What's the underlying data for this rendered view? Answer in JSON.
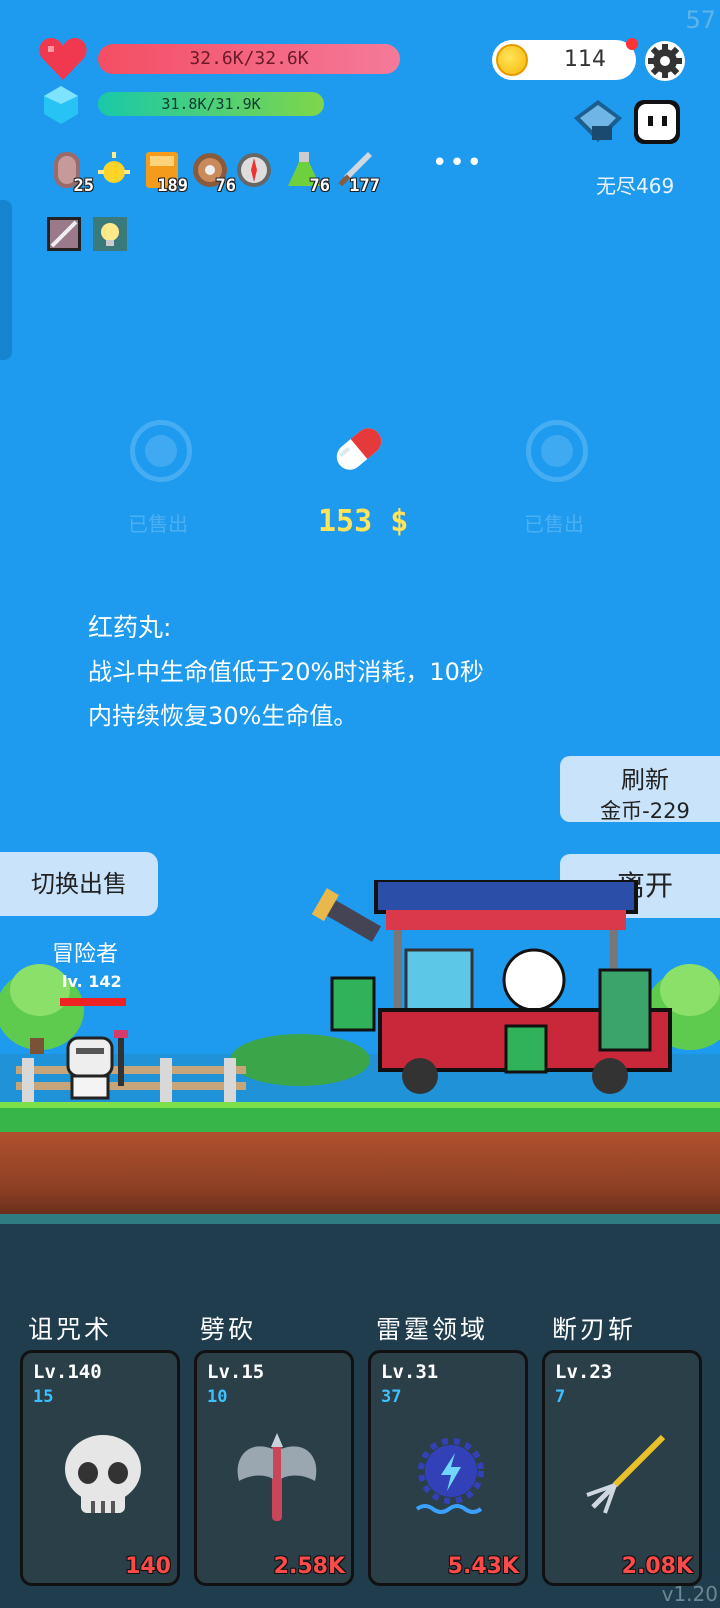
{
  "status": {
    "fps": "57",
    "hp": "32.6K/32.6K",
    "mp": "31.8K/31.9K",
    "coins": "114",
    "mode": "无尽469"
  },
  "buffs": [
    {
      "icon": "tombstone-icon",
      "count": "25"
    },
    {
      "icon": "sun-icon",
      "count": ""
    },
    {
      "icon": "book-icon",
      "count": "189"
    },
    {
      "icon": "shield-icon",
      "count": "76"
    },
    {
      "icon": "compass-icon",
      "count": ""
    },
    {
      "icon": "potion-icon",
      "count": "76"
    },
    {
      "icon": "sword-icon",
      "count": "177"
    }
  ],
  "more_label": "•••",
  "shop": {
    "left_slot": "已售出",
    "right_slot": "已售出",
    "price": "153 $",
    "item_title": "红药丸:",
    "item_desc_line1": "战斗中生命值低于20%时消耗，10秒",
    "item_desc_line2": "内持续恢复30%生命值。",
    "refresh_label": "刷新",
    "refresh_cost": "金币-229",
    "leave_label": "离开",
    "switch_label": "切换出售"
  },
  "hero": {
    "name": "冒险者",
    "level": "lv. 142"
  },
  "skills": [
    {
      "name": "诅咒术",
      "level": "Lv.140",
      "count": "15",
      "value": "140",
      "icon": "skull-icon"
    },
    {
      "name": "劈砍",
      "level": "Lv.15",
      "count": "10",
      "value": "2.58K",
      "icon": "axe-icon"
    },
    {
      "name": "雷霆领域",
      "level": "Lv.31",
      "count": "37",
      "value": "5.43K",
      "icon": "thunder-icon"
    },
    {
      "name": "断刃斩",
      "level": "Lv.23",
      "count": "7",
      "value": "2.08K",
      "icon": "trident-icon"
    }
  ],
  "version": "v1.20",
  "colors": {
    "sky": "#1e9bef",
    "hp": "#f44e63",
    "mp": "#19c9a8",
    "price": "#ffe35a",
    "skill_value": "#ff4a4a"
  }
}
